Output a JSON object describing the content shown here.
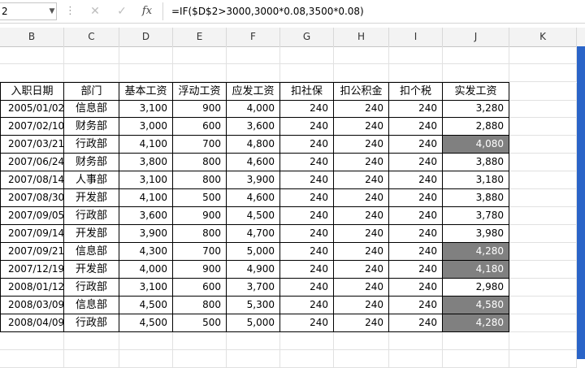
{
  "formula_bar": {
    "name_box": "2",
    "dots": "⋮",
    "cancel_glyph": "✕",
    "confirm_glyph": "✓",
    "fx_label": "fx",
    "formula": "=IF($D$2>3000,3000*0.08,3500*0.08)"
  },
  "columns": [
    "B",
    "C",
    "D",
    "E",
    "F",
    "G",
    "H",
    "I",
    "J",
    "K"
  ],
  "table": {
    "headers": [
      "入职日期",
      "部门",
      "基本工资",
      "浮动工资",
      "应发工资",
      "扣社保",
      "扣公积金",
      "扣个税",
      "实发工资"
    ],
    "rows": [
      {
        "date": "2005/01/02",
        "dept": "信息部",
        "base": "3,100",
        "float": "900",
        "gross": "4,000",
        "ss": "240",
        "hf": "240",
        "tax": "240",
        "net": "3,280",
        "hl": false
      },
      {
        "date": "2007/02/10",
        "dept": "财务部",
        "base": "3,000",
        "float": "600",
        "gross": "3,600",
        "ss": "240",
        "hf": "240",
        "tax": "240",
        "net": "2,880",
        "hl": false
      },
      {
        "date": "2007/03/21",
        "dept": "行政部",
        "base": "4,100",
        "float": "700",
        "gross": "4,800",
        "ss": "240",
        "hf": "240",
        "tax": "240",
        "net": "4,080",
        "hl": true
      },
      {
        "date": "2007/06/24",
        "dept": "财务部",
        "base": "3,800",
        "float": "800",
        "gross": "4,600",
        "ss": "240",
        "hf": "240",
        "tax": "240",
        "net": "3,880",
        "hl": false
      },
      {
        "date": "2007/08/14",
        "dept": "人事部",
        "base": "3,100",
        "float": "800",
        "gross": "3,900",
        "ss": "240",
        "hf": "240",
        "tax": "240",
        "net": "3,180",
        "hl": false
      },
      {
        "date": "2007/08/30",
        "dept": "开发部",
        "base": "4,100",
        "float": "500",
        "gross": "4,600",
        "ss": "240",
        "hf": "240",
        "tax": "240",
        "net": "3,880",
        "hl": false
      },
      {
        "date": "2007/09/05",
        "dept": "行政部",
        "base": "3,600",
        "float": "900",
        "gross": "4,500",
        "ss": "240",
        "hf": "240",
        "tax": "240",
        "net": "3,780",
        "hl": false
      },
      {
        "date": "2007/09/14",
        "dept": "开发部",
        "base": "3,900",
        "float": "800",
        "gross": "4,700",
        "ss": "240",
        "hf": "240",
        "tax": "240",
        "net": "3,980",
        "hl": false
      },
      {
        "date": "2007/09/21",
        "dept": "信息部",
        "base": "4,300",
        "float": "700",
        "gross": "5,000",
        "ss": "240",
        "hf": "240",
        "tax": "240",
        "net": "4,280",
        "hl": true
      },
      {
        "date": "2007/12/19",
        "dept": "开发部",
        "base": "4,000",
        "float": "900",
        "gross": "4,900",
        "ss": "240",
        "hf": "240",
        "tax": "240",
        "net": "4,180",
        "hl": true
      },
      {
        "date": "2008/01/12",
        "dept": "行政部",
        "base": "3,100",
        "float": "600",
        "gross": "3,700",
        "ss": "240",
        "hf": "240",
        "tax": "240",
        "net": "2,980",
        "hl": false
      },
      {
        "date": "2008/03/09",
        "dept": "信息部",
        "base": "4,500",
        "float": "800",
        "gross": "5,300",
        "ss": "240",
        "hf": "240",
        "tax": "240",
        "net": "4,580",
        "hl": true
      },
      {
        "date": "2008/04/09",
        "dept": "行政部",
        "base": "4,500",
        "float": "500",
        "gross": "5,000",
        "ss": "240",
        "hf": "240",
        "tax": "240",
        "net": "4,280",
        "hl": true
      }
    ]
  },
  "colors": {
    "highlight_fill": "#808080",
    "highlight_text": "#ffffff",
    "scrollbar": "#2a64c8"
  }
}
